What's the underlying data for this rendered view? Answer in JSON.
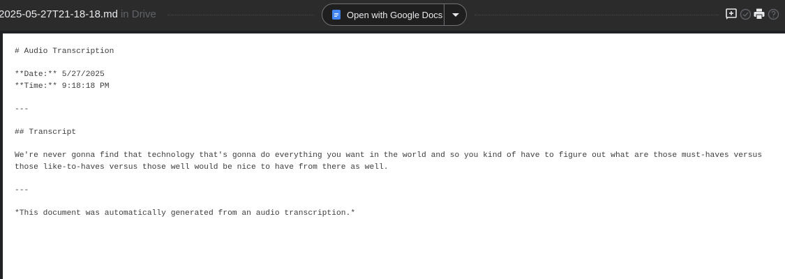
{
  "header": {
    "file_name": "2025-05-27T21-18-18.md",
    "location": "in Drive",
    "open_with_label": "Open with Google Docs"
  },
  "toolbar_icons": [
    "add-comment-icon",
    "checkmark-circle-icon",
    "print-icon",
    "help-icon"
  ],
  "document": {
    "lines": [
      "# Audio Transcription",
      "",
      "**Date:** 5/27/2025",
      "**Time:** 9:18:18 PM",
      "",
      "---",
      "",
      "## Transcript",
      "",
      "We're never gonna find that technology that's gonna do everything you want in the world and so you kind of have to figure out what are those must-haves versus",
      "those like-to-haves versus those well would be nice to have from there as well.",
      "",
      "---",
      "",
      "*This document was automatically generated from an audio transcription.*"
    ]
  }
}
